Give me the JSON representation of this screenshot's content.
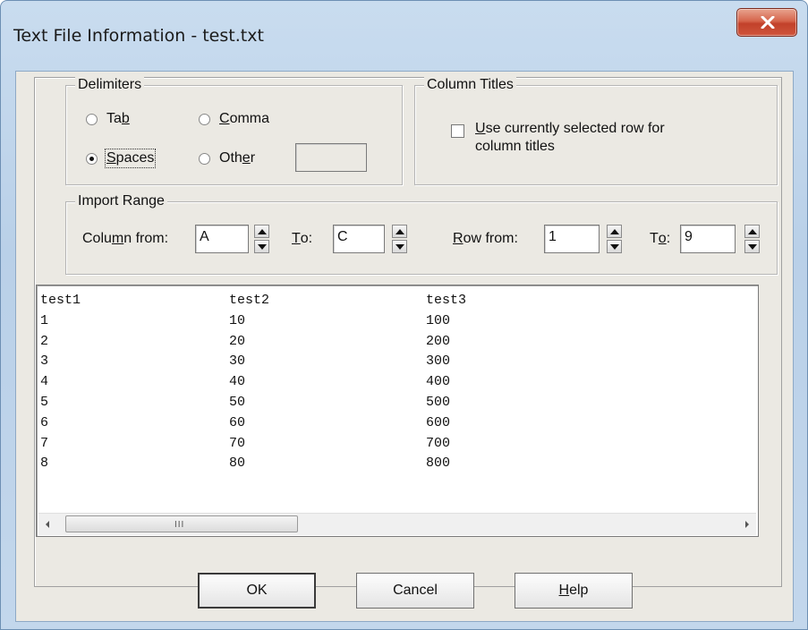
{
  "window": {
    "title": "Text File Information - test.txt",
    "close_icon": "close-icon"
  },
  "delimiters": {
    "legend": "Delimiters",
    "tab": {
      "pre": "Ta",
      "accel": "b",
      "post": ""
    },
    "comma": {
      "pre": "",
      "accel": "C",
      "post": "omma"
    },
    "spaces": {
      "pre": "",
      "accel": "S",
      "post": "paces",
      "selected": true
    },
    "other": {
      "pre": "Oth",
      "accel": "e",
      "post": "r",
      "value": ""
    }
  },
  "column_titles": {
    "legend": "Column Titles",
    "checkbox": {
      "accel": "U",
      "line1_rest": "se currently selected row for",
      "line2": "column titles",
      "checked": false
    }
  },
  "import_range": {
    "legend": "Import Range",
    "column_from": {
      "pre": "Colu",
      "accel": "m",
      "post": "n from:",
      "value": "A"
    },
    "column_to": {
      "pre": "",
      "accel": "T",
      "post": "o:",
      "value": "C"
    },
    "row_from": {
      "pre": "",
      "accel": "R",
      "post": "ow from:",
      "value": "1"
    },
    "row_to": {
      "pre": "T",
      "accel": "o",
      "post": ":",
      "value": "9"
    }
  },
  "preview": {
    "rows": [
      [
        "test1",
        "test2",
        "test3"
      ],
      [
        "1",
        "10",
        "100"
      ],
      [
        "2",
        "20",
        "200"
      ],
      [
        "3",
        "30",
        "300"
      ],
      [
        "4",
        "40",
        "400"
      ],
      [
        "5",
        "50",
        "500"
      ],
      [
        "6",
        "60",
        "600"
      ],
      [
        "7",
        "70",
        "700"
      ],
      [
        "8",
        "80",
        "800"
      ]
    ],
    "scroll_grip": "III"
  },
  "buttons": {
    "ok": "OK",
    "cancel": "Cancel",
    "help": {
      "pre": "",
      "accel": "H",
      "post": "elp"
    }
  }
}
